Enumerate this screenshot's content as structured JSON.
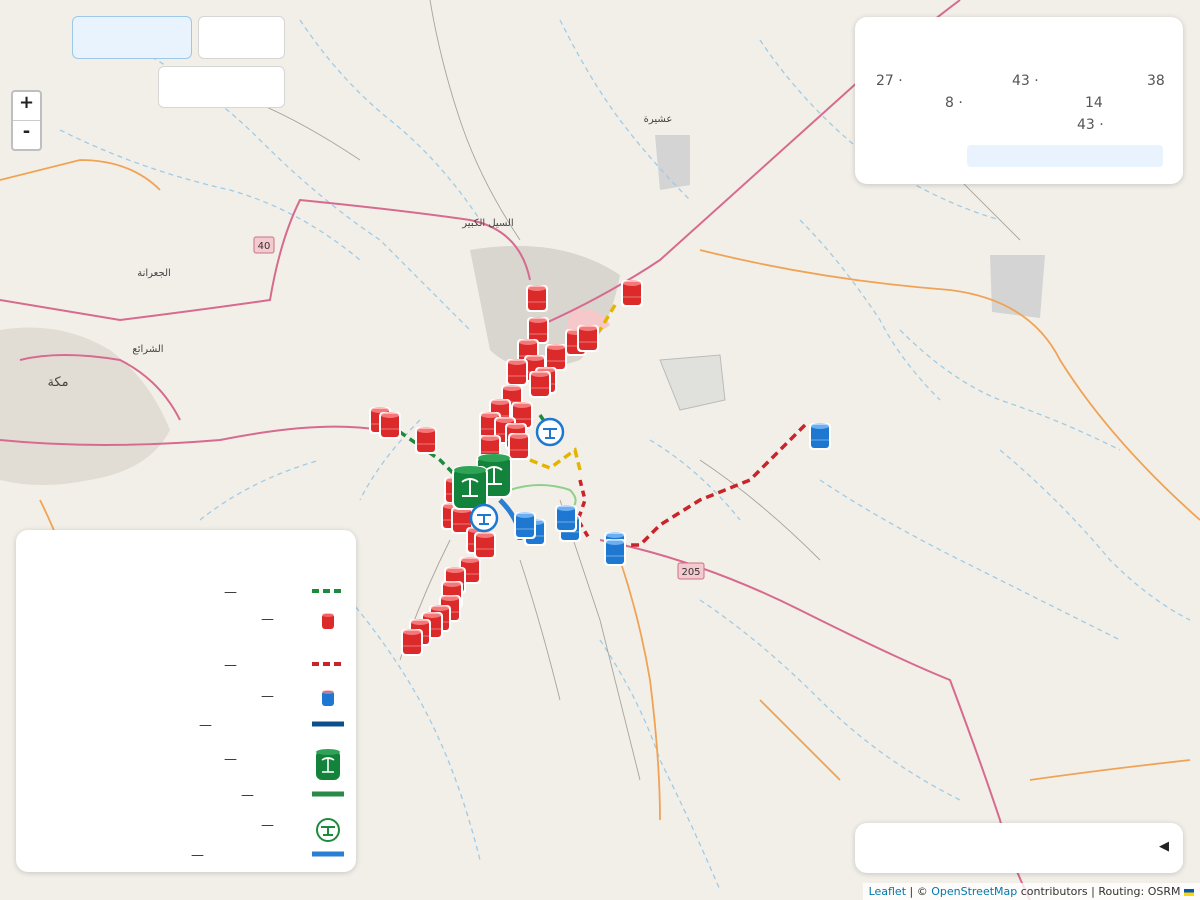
{
  "map": {
    "places": [
      {
        "name": "عشيرة"
      },
      {
        "name": "السيل الكبير"
      },
      {
        "name": "الجعرانة"
      },
      {
        "name": "الشرائع"
      },
      {
        "name": "مكة"
      }
    ],
    "road_shields": [
      "40",
      "205"
    ]
  },
  "zoom": {
    "in_label": "+",
    "out_label": "-"
  },
  "stats": {
    "values": [
      "27",
      "43",
      "38",
      "8",
      "14",
      "43"
    ]
  },
  "legend": {
    "dash": "—",
    "items": [
      {
        "icon": "green-dashed-line",
        "color": "#1e8a3c"
      },
      {
        "icon": "red-tank-icon",
        "color": "#dc2a2a"
      },
      {
        "icon": "red-dashed-line",
        "color": "#c8242a"
      },
      {
        "icon": "blue-tank-icon",
        "color": "#1e78d2"
      },
      {
        "icon": "navy-solid-line",
        "color": "#0d4f8b"
      },
      {
        "icon": "green-emblem-tank-icon",
        "color": "#13823a"
      },
      {
        "icon": "green-solid-line",
        "color": "#2a8a48"
      },
      {
        "icon": "green-valve-icon",
        "color": "#1e8a3c"
      },
      {
        "icon": "blue-solid-line",
        "color": "#2a7fd4"
      }
    ]
  },
  "bottom_panel": {
    "toggle_icon": "◀"
  },
  "attribution": {
    "leaflet": "Leaflet",
    "sep1": " | © ",
    "osm": "OpenStreetMap",
    "rest": " contributors | Routing: OSRM"
  },
  "colors": {
    "red_tank": "#dc2a2a",
    "blue_tank": "#1e78d2",
    "green_tank": "#13823a",
    "route_red": "#c8242a",
    "route_green": "#1e8a3c",
    "route_yellow": "#e4b400",
    "road_pink": "#d76a8f",
    "road_orange": "#f0a354",
    "water": "#9fcbe6"
  }
}
